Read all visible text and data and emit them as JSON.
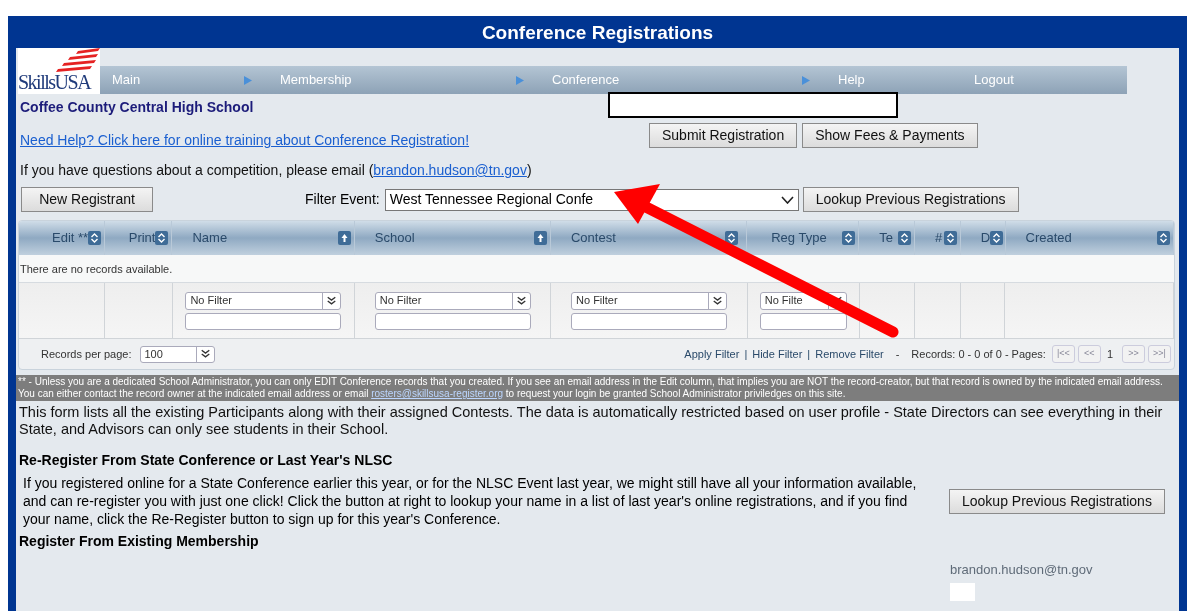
{
  "title": "Conference Registrations",
  "logo": "SkillsUSA",
  "action_separator": "|",
  "nav": [
    {
      "label": "Main",
      "arrow": true
    },
    {
      "label": "Membership",
      "arrow": true
    },
    {
      "label": "Conference",
      "arrow": true
    },
    {
      "label": "Help",
      "arrow": false
    },
    {
      "label": "Logout",
      "arrow": false
    }
  ],
  "school": "Coffee County Central High School",
  "help_link": "Need Help? Click here for online training about Conference Registration!",
  "buttons": [
    "Submit Registration",
    "Show Fees & Payments"
  ],
  "question": {
    "text": "If you have questions about a competition, please email (",
    "email": "brandon.hudson@tn.gov",
    "end": ")"
  },
  "new_registrant": "New Registrant",
  "filter": {
    "label": "Filter Event:",
    "value": "West Tennessee Regional Confe"
  },
  "lookup_button": "Lookup Previous Registrations",
  "table": {
    "columns": [
      {
        "label": "Edit **",
        "sorted": false,
        "filter": false
      },
      {
        "label": "Print",
        "sorted": false,
        "filter": false
      },
      {
        "label": "Name",
        "sorted": true,
        "filter": true,
        "filter_value": "No Filter"
      },
      {
        "label": "School",
        "sorted": true,
        "filter": true,
        "filter_value": "No Filter"
      },
      {
        "label": "Contest",
        "sorted": false,
        "filter": true,
        "filter_value": "No Filter"
      },
      {
        "label": "Reg Type",
        "sorted": false,
        "filter": true,
        "filter_value": "No Filte"
      },
      {
        "label": "Te",
        "sorted": false,
        "filter": false
      },
      {
        "label": "#",
        "sorted": false,
        "filter": false
      },
      {
        "label": "D",
        "sorted": false,
        "filter": false
      },
      {
        "label": "Created",
        "sorted": false,
        "filter": false
      }
    ],
    "empty": "There are no records available.",
    "per_page_label": "Records per page:",
    "per_page": "100",
    "actions": [
      "Apply Filter",
      "Hide Filter",
      "Remove Filter"
    ],
    "dash": "-",
    "records": "Records: 0 - 0 of 0 - Pages:",
    "pager": [
      "|<<",
      "<<",
      "1",
      ">>",
      ">>|"
    ]
  },
  "note": {
    "text": "** - Unless you are a dedicated School Administrator, you can only EDIT Conference records that you created. If you see an email address in the Edit column, that implies you are NOT the record-creator, but that record is owned by the indicated email address. You can either contact the record owner at the indicated email address or email ",
    "link": "rosters@skillsusa-register.org",
    "end": " to request your login be granted School Administrator priviledges on this site."
  },
  "info": "This form lists all the existing Participants along with their assigned Contests. The data is automatically restricted based on user profile - State Directors can see everything in their State, and Advisors can only see students in their School.",
  "reregister": {
    "heading": "Re-Register From State Conference or Last Year's NLSC",
    "text": "If you registered online for a State Conference earlier this year, or for the NLSC Event last year, we might still have all your information available, and can re-register you with just one click! Click the button at right to lookup your name in a list of last year's online registrations, and if you find your name, click the Re-Register button to sign up for this year's Conference.",
    "button": "Lookup Previous Registrations"
  },
  "existing_heading": "Register From Existing Membership",
  "footer_email": "brandon.hudson@tn.gov"
}
